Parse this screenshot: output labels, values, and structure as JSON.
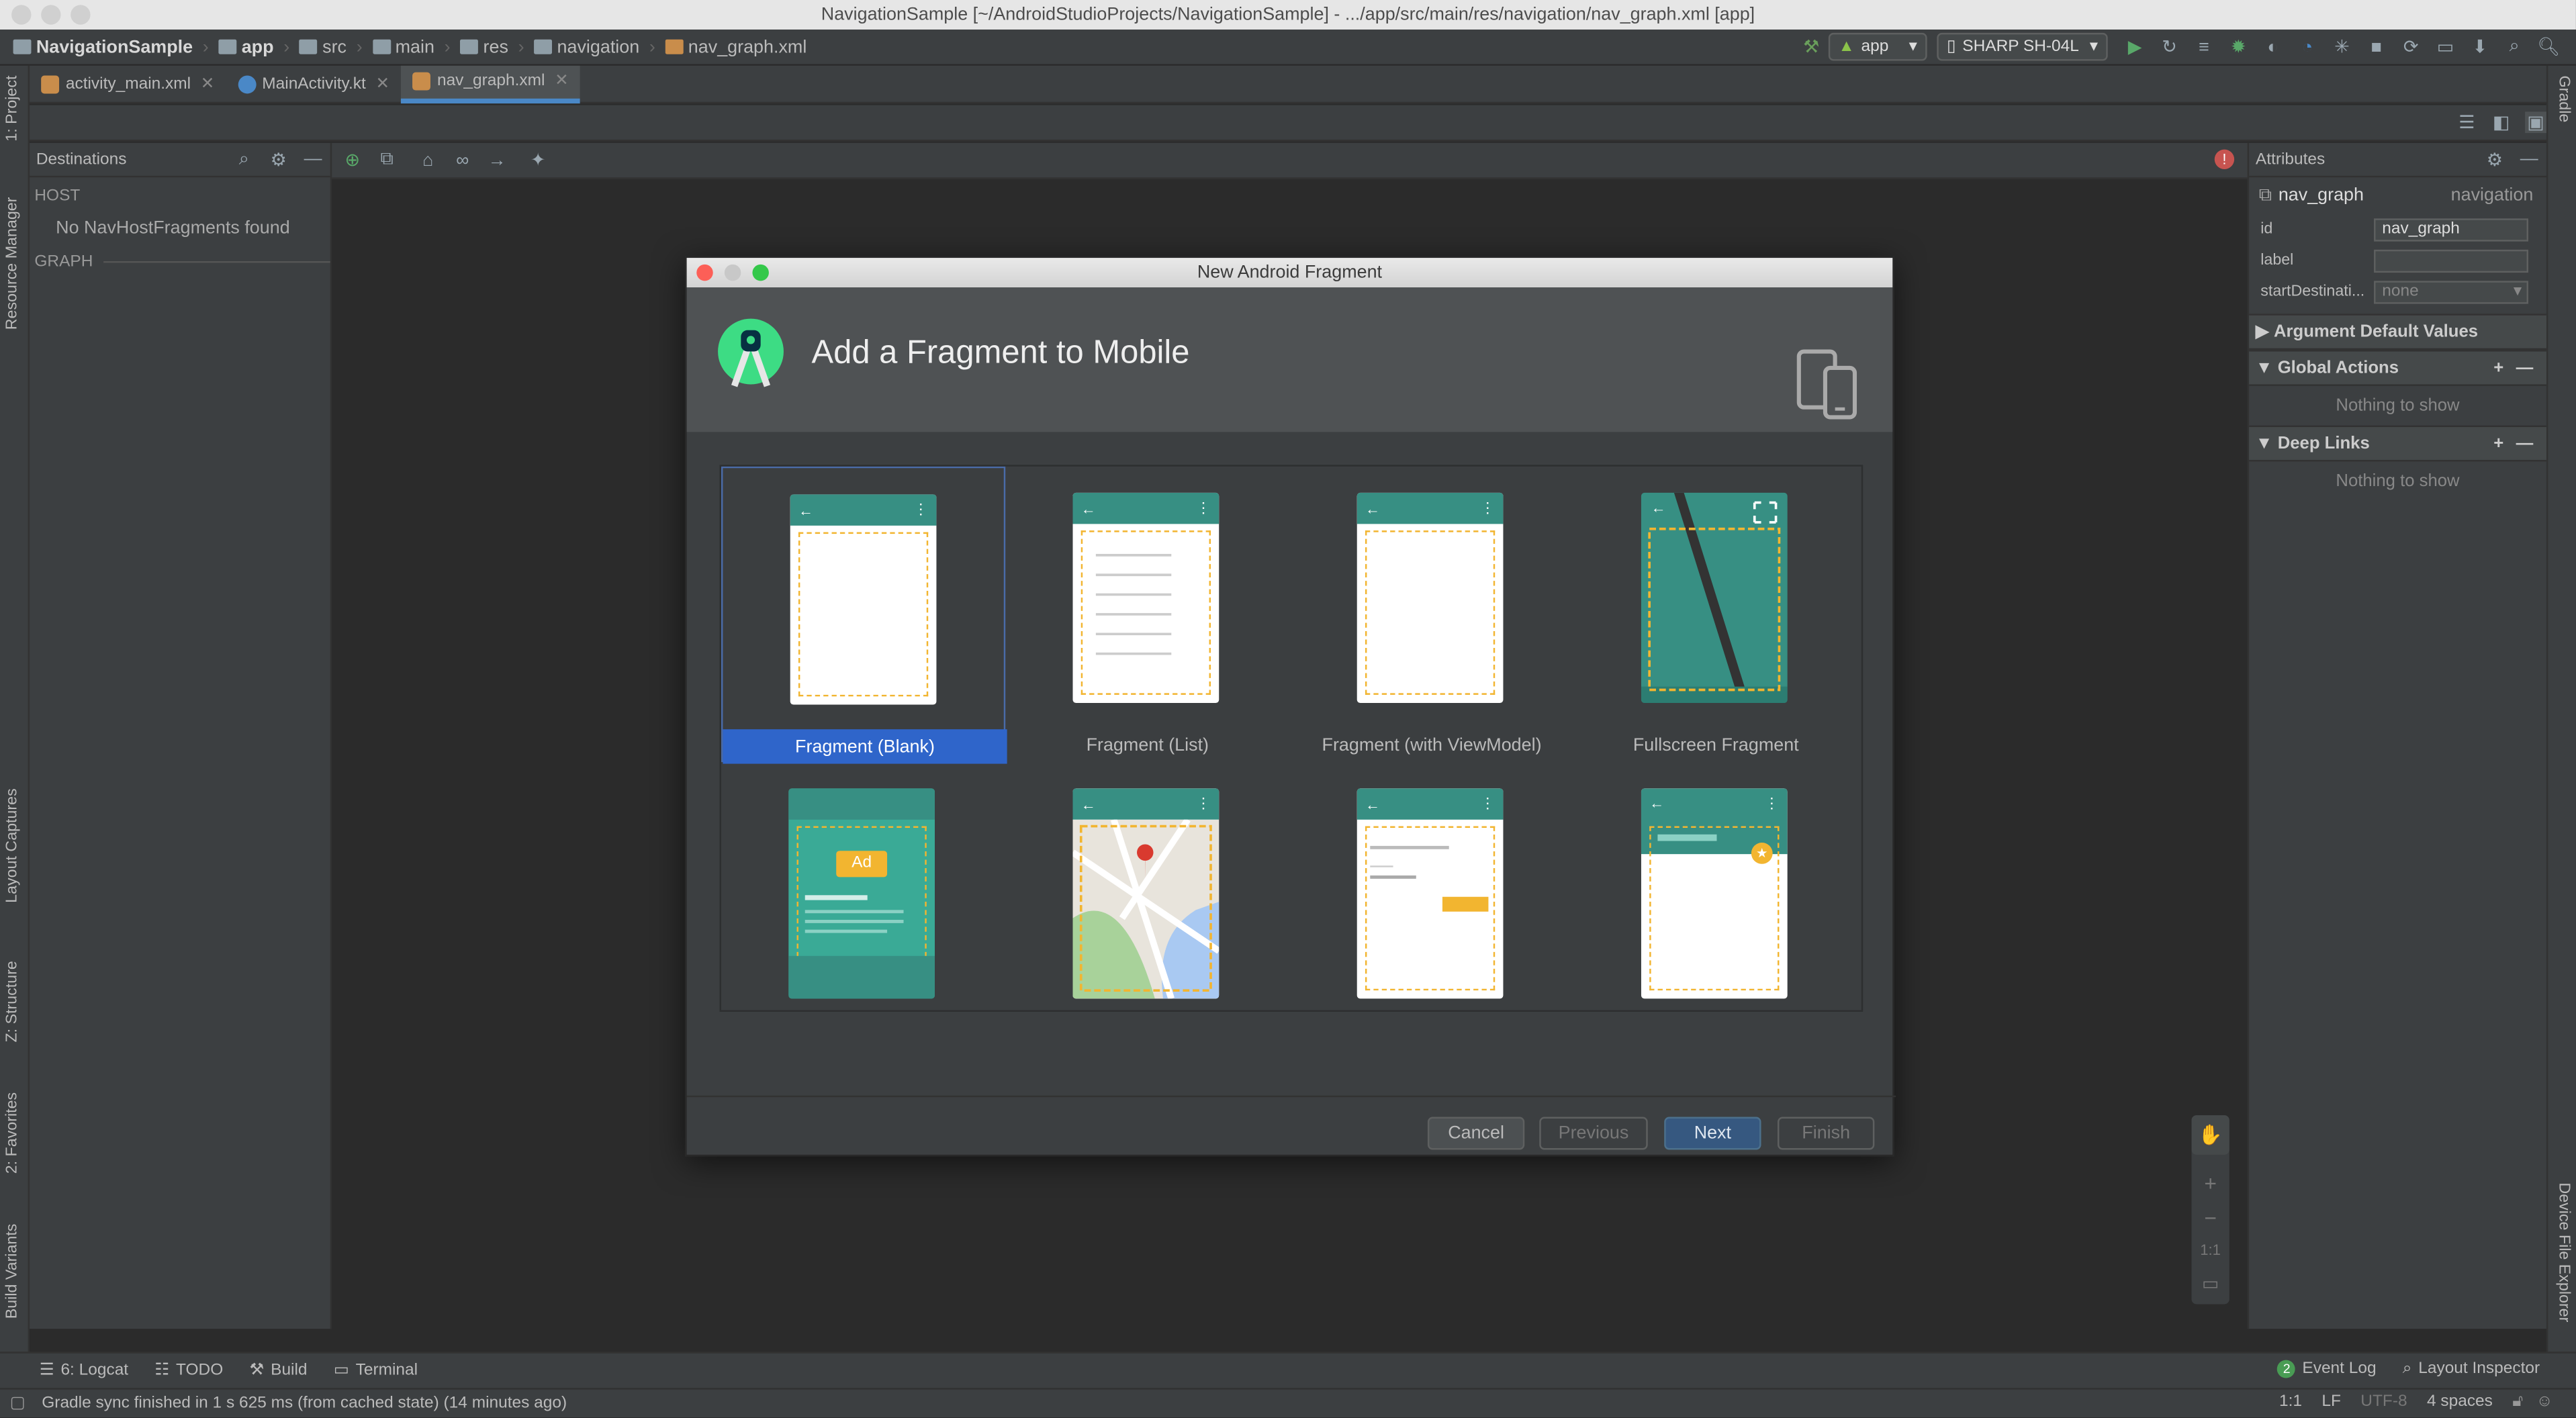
{
  "window_title": "NavigationSample [~/AndroidStudioProjects/NavigationSample] - .../app/src/main/res/navigation/nav_graph.xml [app]",
  "breadcrumbs": [
    "NavigationSample",
    "app",
    "src",
    "main",
    "res",
    "navigation",
    "nav_graph.xml"
  ],
  "run_config": "app",
  "device": "SHARP SH-04L",
  "tabs": [
    {
      "label": "activity_main.xml",
      "active": false
    },
    {
      "label": "MainActivity.kt",
      "active": false
    },
    {
      "label": "nav_graph.xml",
      "active": true
    }
  ],
  "left_stripe": {
    "project": "1: Project",
    "resource_manager": "Resource Manager",
    "layout_captures": "Layout Captures",
    "structure": "Z: Structure",
    "favorites": "2: Favorites",
    "build_variants": "Build Variants"
  },
  "right_stripe": {
    "gradle": "Gradle",
    "device_file_explorer": "Device File Explorer"
  },
  "destinations": {
    "title": "Destinations",
    "host_header": "HOST",
    "host_empty": "No NavHostFragments found",
    "graph_header": "GRAPH"
  },
  "attributes": {
    "title": "Attributes",
    "graph_name": "nav_graph",
    "graph_type": "navigation",
    "id_label": "id",
    "id_value": "nav_graph",
    "label_label": "label",
    "label_value": "",
    "start_label": "startDestinati...",
    "start_value": "none",
    "sections": [
      {
        "title": "Argument Default Values",
        "expanded": false,
        "empty": ""
      },
      {
        "title": "Global Actions",
        "expanded": true,
        "empty": "Nothing to show"
      },
      {
        "title": "Deep Links",
        "expanded": true,
        "empty": "Nothing to show"
      }
    ]
  },
  "dialog": {
    "title": "New Android Fragment",
    "heading": "Add a Fragment to Mobile",
    "templates": [
      {
        "label": "Fragment (Blank)",
        "selected": true
      },
      {
        "label": "Fragment (List)",
        "selected": false
      },
      {
        "label": "Fragment (with ViewModel)",
        "selected": false
      },
      {
        "label": "Fullscreen Fragment",
        "selected": false
      },
      {
        "label": "",
        "selected": false
      },
      {
        "label": "",
        "selected": false
      },
      {
        "label": "",
        "selected": false
      },
      {
        "label": "",
        "selected": false
      }
    ],
    "ad_text": "Ad",
    "buttons": {
      "cancel": "Cancel",
      "previous": "Previous",
      "next": "Next",
      "finish": "Finish"
    }
  },
  "zoom": {
    "reset": "1:1"
  },
  "bottom_tools": [
    {
      "label": "6: Logcat"
    },
    {
      "label": "TODO"
    },
    {
      "label": "Build"
    },
    {
      "label": "Terminal"
    }
  ],
  "bottom_right_tools": {
    "event_log_count": "2",
    "event_log": "Event Log",
    "layout_inspector": "Layout Inspector"
  },
  "status": {
    "message": "Gradle sync finished in 1 s 625 ms (from cached state) (14 minutes ago)",
    "position": "1:1",
    "line_sep": "LF",
    "encoding": "UTF-8",
    "indent": "4 spaces"
  },
  "colors": {
    "accent": "#4a88c7",
    "selection": "#2f65ca",
    "teal": "#378f83",
    "dashed": "#f2b530",
    "default_button": "#365880"
  }
}
